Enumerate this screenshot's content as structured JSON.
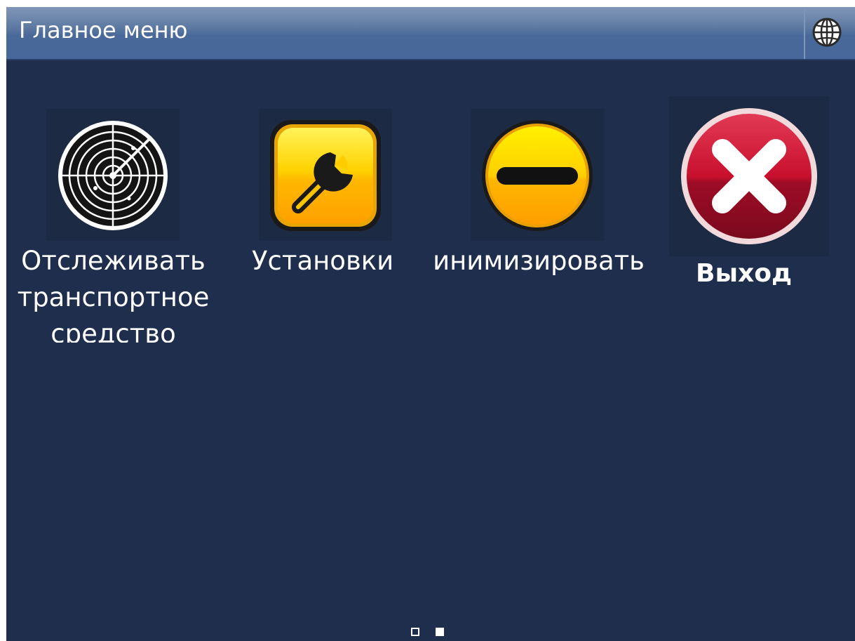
{
  "header": {
    "title": "Главное меню",
    "language_icon": "globe-icon"
  },
  "menu": {
    "items": [
      {
        "label": "Отслеживать транспортное средство",
        "icon": "radar-icon"
      },
      {
        "label": "Установки",
        "icon": "wrench-icon"
      },
      {
        "label": "Минимизировать",
        "icon": "minus-icon"
      },
      {
        "label": "Выход",
        "icon": "close-icon"
      }
    ]
  },
  "pager": {
    "pages": 2,
    "current": 2
  },
  "colors": {
    "background": "#1f2e4c",
    "titlebar": "#48679a",
    "accent_yellow": "#ffcc00",
    "exit_red": "#c41e3a"
  }
}
